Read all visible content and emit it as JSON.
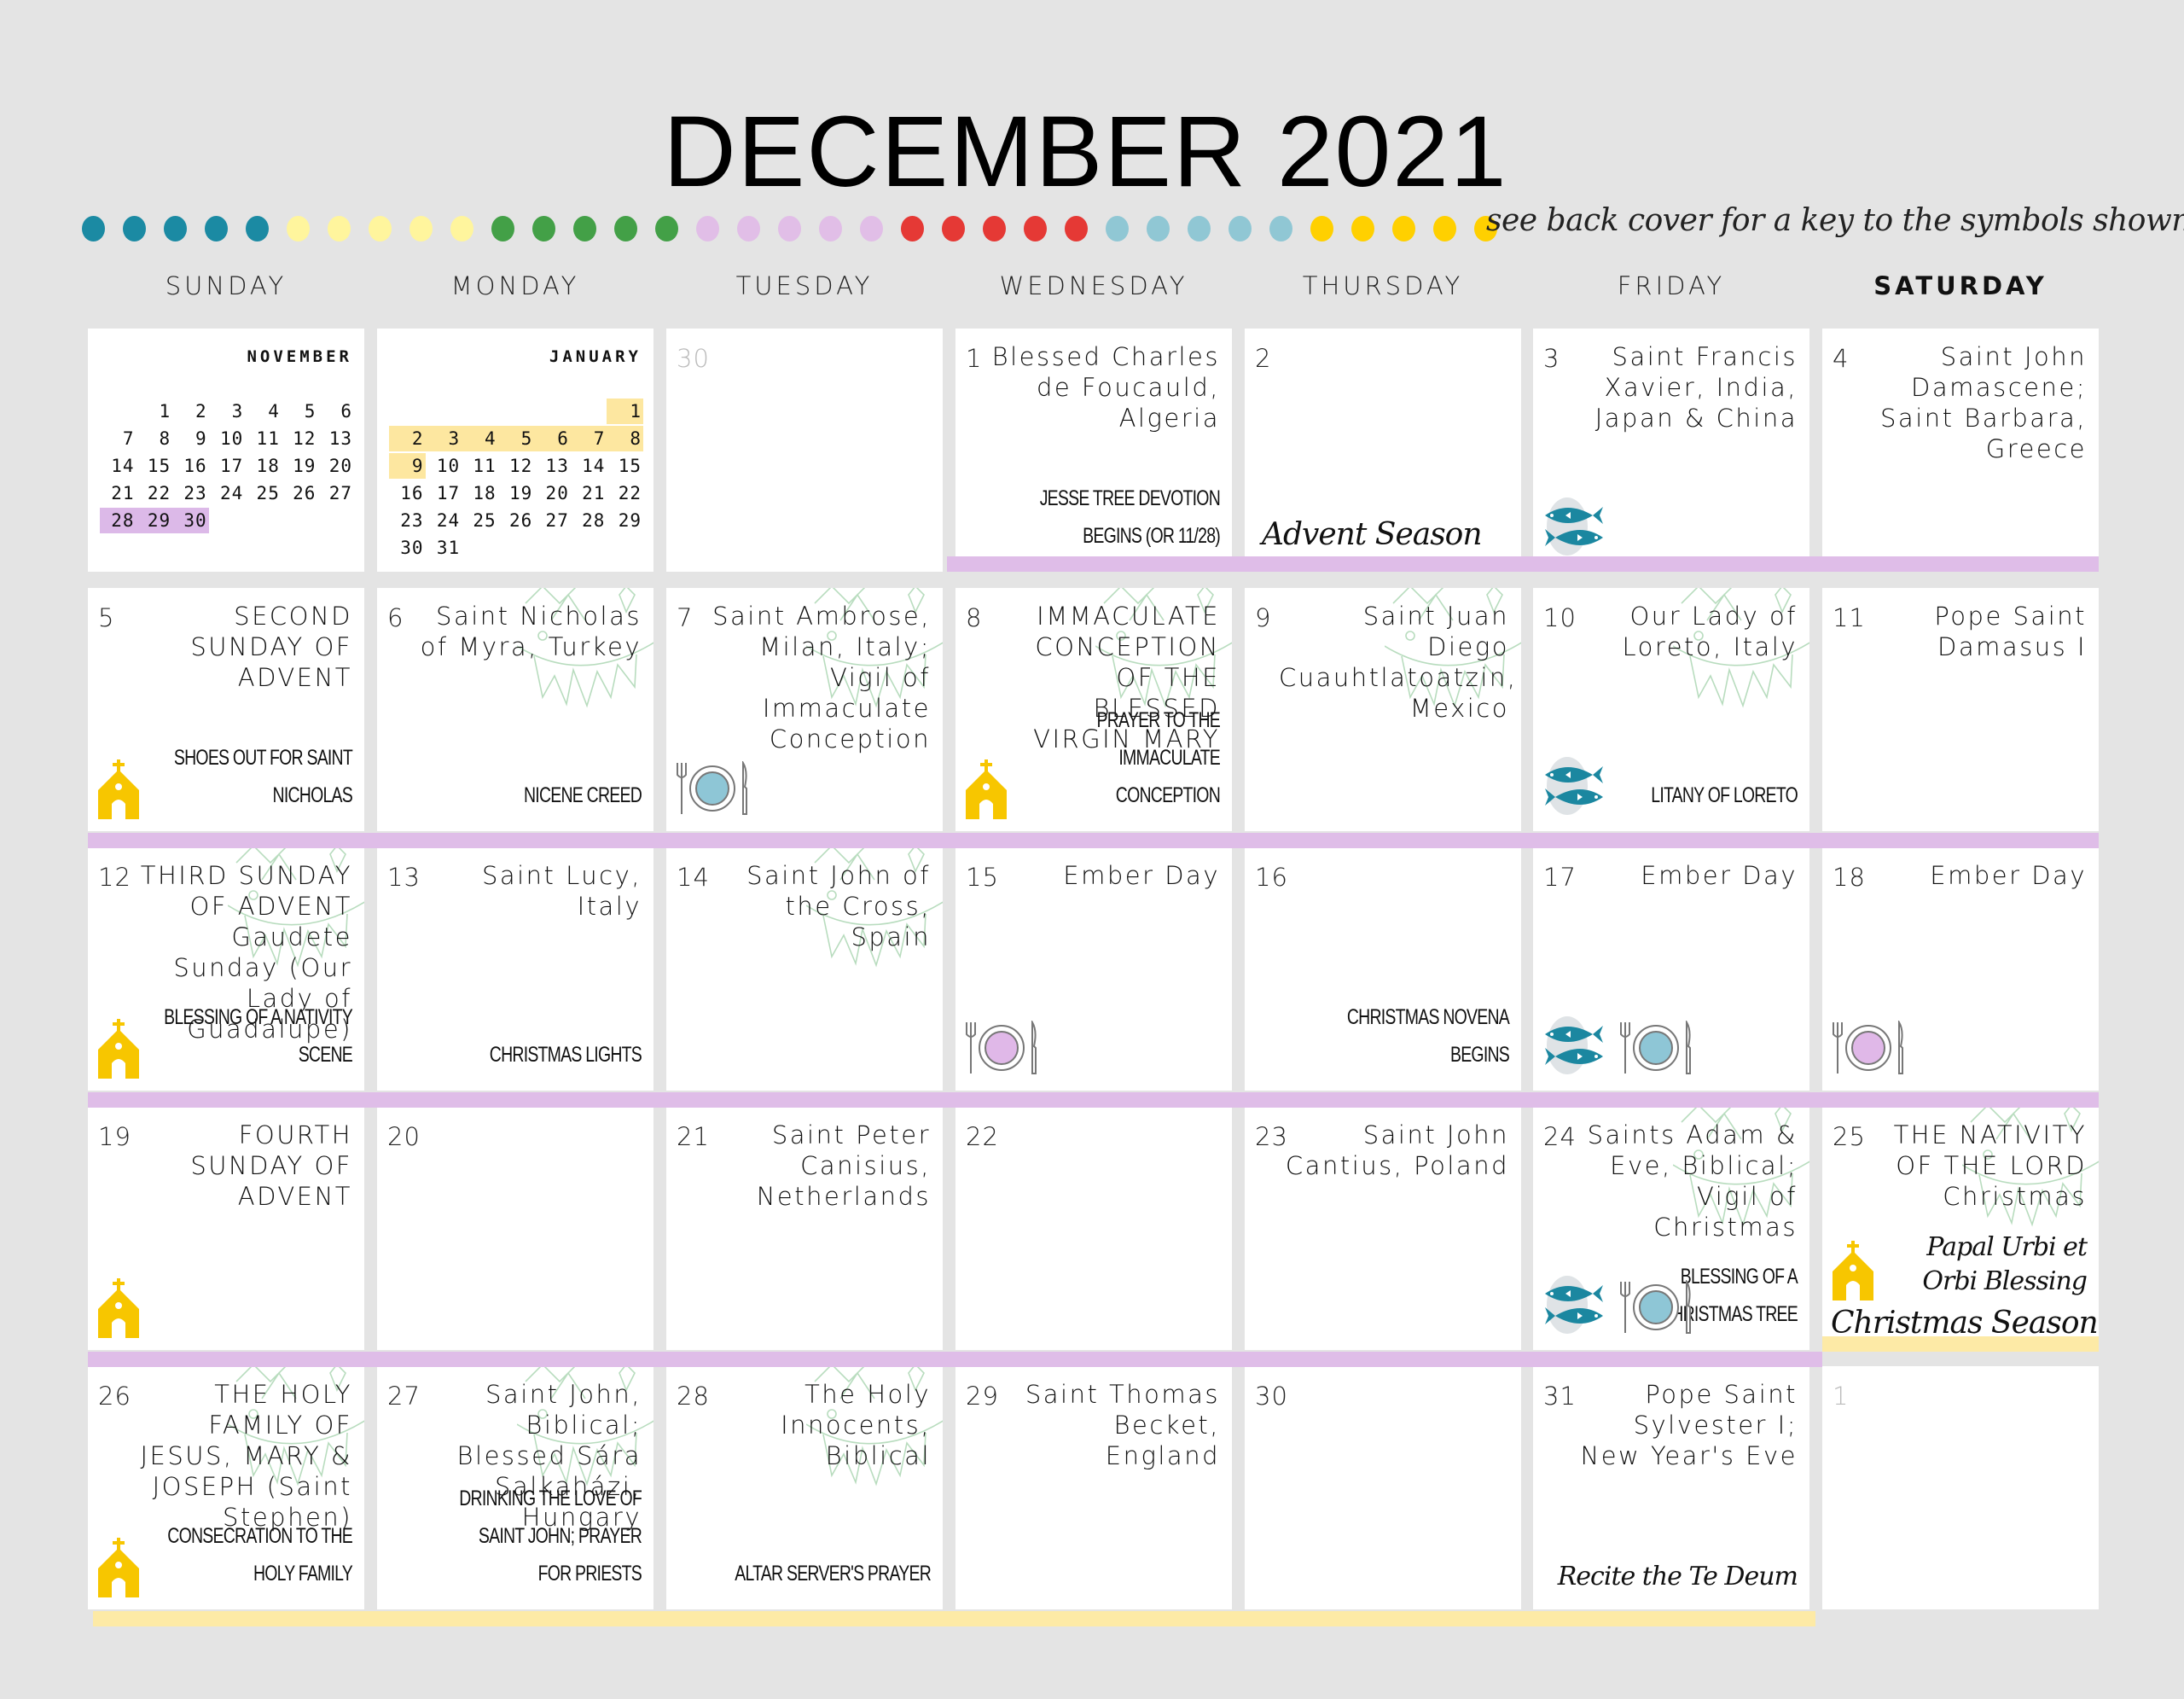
{
  "header": {
    "title": "DECEMBER 2021",
    "key_note": "see back cover for a key to the symbols shown",
    "dot_colors": [
      "#1b8aa3",
      "#fff59d",
      "#43a047",
      "#e1bee7",
      "#e53935",
      "#90c7d4",
      "#ffd000"
    ]
  },
  "weekdays": [
    "SUNDAY",
    "MONDAY",
    "TUESDAY",
    "WEDNESDAY",
    "THURSDAY",
    "FRIDAY",
    "SATURDAY"
  ],
  "colors": {
    "advent_bar": "#dfbde8",
    "christmas_bar": "#fdeaa6",
    "church_icon": "#f7c600",
    "fish_icon": "#1b87a0",
    "plate_blue": "#8ec6d6",
    "plate_purple": "#e0b8e8"
  },
  "mini_calendars": {
    "november": {
      "title": "NOVEMBER",
      "leading_blanks": 1,
      "days": 30,
      "highlight": [
        28,
        29,
        30
      ],
      "highlight_color": "purple"
    },
    "january": {
      "title": "JANUARY",
      "leading_blanks": 6,
      "days": 31,
      "highlight": [
        1,
        2,
        3,
        4,
        5,
        6,
        7,
        8,
        9
      ],
      "highlight_color": "yellow"
    }
  },
  "weeks": [
    [
      {
        "type": "mini",
        "ref": "november"
      },
      {
        "type": "mini",
        "ref": "january"
      },
      {
        "day": "30",
        "muted": true
      },
      {
        "day": "1",
        "feast": "Blessed Charles de Foucauld, Algeria",
        "note": "Jesse Tree Devotion Begins (or 11/28)"
      },
      {
        "day": "2",
        "season": "Advent Season"
      },
      {
        "day": "3",
        "feast": "Saint Francis Xavier, India, Japan & China",
        "icons": [
          "fish"
        ]
      },
      {
        "day": "4",
        "feast": "Saint John Damascene; Saint Barbara, Greece"
      }
    ],
    [
      {
        "day": "5",
        "feast": "SECOND SUNDAY OF ADVENT",
        "note": "Shoes out for Saint Nicholas",
        "icons": [
          "church"
        ]
      },
      {
        "day": "6",
        "feast": "Saint Nicholas of Myra, Turkey",
        "note": "Nicene Creed",
        "bunting": true
      },
      {
        "day": "7",
        "feast": "Saint Ambrose, Milan, Italy; Vigil of Immaculate Conception",
        "icons": [
          "plate-blue"
        ],
        "bunting": true
      },
      {
        "day": "8",
        "feast": "IMMACULATE CONCEPTION OF THE BLESSED VIRGIN MARY",
        "note": "Prayer to the Immaculate Conception",
        "icons": [
          "church"
        ],
        "bunting": true
      },
      {
        "day": "9",
        "feast": "Saint Juan Diego Cuauhtlatoatzin, Mexico",
        "bunting": true
      },
      {
        "day": "10",
        "feast": "Our Lady of Loreto, Italy",
        "note": "Litany of Loreto",
        "icons": [
          "fish"
        ],
        "bunting": true
      },
      {
        "day": "11",
        "feast": "Pope Saint Damasus I"
      }
    ],
    [
      {
        "day": "12",
        "feast": "THIRD SUNDAY OF ADVENT Gaudete Sunday (Our Lady of Guadalupe)",
        "note": "Blessing of a Nativity Scene",
        "icons": [
          "church"
        ],
        "bunting": true
      },
      {
        "day": "13",
        "feast": "Saint Lucy, Italy",
        "note": "Christmas Lights"
      },
      {
        "day": "14",
        "feast": "Saint John of the Cross, Spain",
        "bunting": true
      },
      {
        "day": "15",
        "feast": "Ember Day",
        "icons": [
          "plate-purple"
        ]
      },
      {
        "day": "16",
        "note": "Christmas Novena Begins"
      },
      {
        "day": "17",
        "feast": "Ember Day",
        "icons": [
          "fish",
          "plate-blue"
        ]
      },
      {
        "day": "18",
        "feast": "Ember Day",
        "icons": [
          "plate-purple"
        ]
      }
    ],
    [
      {
        "day": "19",
        "feast": "FOURTH SUNDAY OF ADVENT",
        "icons": [
          "church"
        ]
      },
      {
        "day": "20"
      },
      {
        "day": "21",
        "feast": "Saint Peter Canisius, Netherlands"
      },
      {
        "day": "22"
      },
      {
        "day": "23",
        "feast": "Saint John Cantius, Poland"
      },
      {
        "day": "24",
        "feast": "Saints Adam & Eve, Biblical; Vigil of Christmas",
        "note": "Blessing of a Christmas Tree",
        "icons": [
          "fish",
          "plate-blue"
        ],
        "bunting": true
      },
      {
        "day": "25",
        "feast": "THE NATIVITY OF THE LORD Christmas",
        "script": "Papal Urbi et Orbi Blessing",
        "season": "Christmas Season",
        "icons": [
          "church"
        ],
        "bunting": true
      }
    ],
    [
      {
        "day": "26",
        "feast": "THE HOLY FAMILY OF JESUS, MARY & JOSEPH (Saint Stephen)",
        "note": "Consecration to the Holy Family",
        "icons": [
          "church"
        ],
        "bunting": true
      },
      {
        "day": "27",
        "feast": "Saint John, Biblical; Blessed Sára Salkaházi, Hungary",
        "note": "Drinking the Love of Saint John; Prayer for Priests",
        "bunting": true
      },
      {
        "day": "28",
        "feast": "The Holy Innocents, Biblical",
        "note": "Altar Server's Prayer",
        "bunting": true
      },
      {
        "day": "29",
        "feast": "Saint Thomas Becket, England"
      },
      {
        "day": "30"
      },
      {
        "day": "31",
        "feast": "Pope Saint Sylvester I; New Year's Eve",
        "script": "Recite the Te Deum"
      },
      {
        "day": "1",
        "muted": true
      }
    ]
  ]
}
